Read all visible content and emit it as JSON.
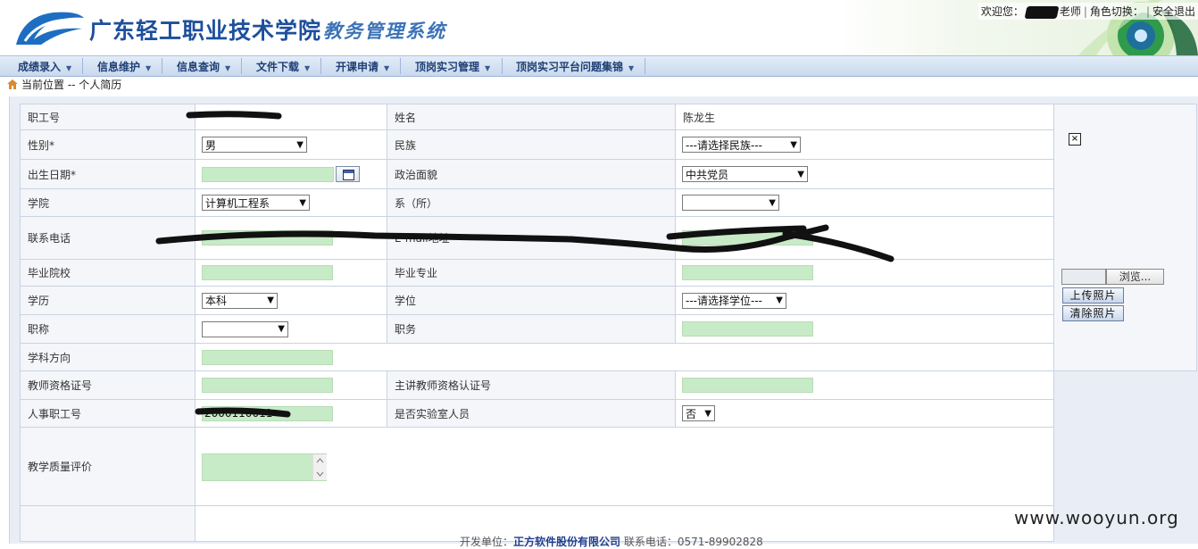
{
  "header": {
    "school_name": "广东轻工职业技术学院",
    "system_name": "教务管理系统",
    "welcome": "欢迎您：",
    "user_suffix": "老师",
    "role_switch": "角色切换：",
    "logout": "安全退出"
  },
  "nav": [
    "成绩录入",
    "信息维护",
    "信息查询",
    "文件下载",
    "开课申请",
    "顶岗实习管理",
    "顶岗实习平台问题集锦"
  ],
  "breadcrumb": "当前位置 -- 个人简历",
  "form": {
    "staff_no_label": "职工号",
    "name_label": "姓名",
    "name_value": "陈龙生",
    "gender_label": "性别*",
    "gender_value": "男",
    "ethnic_label": "民族",
    "ethnic_value": "---请选择民族---",
    "birth_label": "出生日期*",
    "political_label": "政治面貌",
    "political_value": "中共党员",
    "college_label": "学院",
    "college_value": "计算机工程系",
    "dept_label": "系（所）",
    "phone_label": "联系电话",
    "email_label": "E-mail地址",
    "school_label": "毕业院校",
    "major_label": "毕业专业",
    "edu_label": "学历",
    "edu_value": "本科",
    "degree_label": "学位",
    "degree_value": "---请选择学位---",
    "title_label": "职称",
    "post_label": "职务",
    "subject_label": "学科方向",
    "cert_label": "教师资格证号",
    "lecturer_label": "主讲教师资格认证号",
    "hr_no_label": "人事职工号",
    "hr_no_value": "2000110011",
    "lab_label": "是否实验室人员",
    "lab_value": "否",
    "eval_label": "教学质量评价"
  },
  "photo": {
    "browse": "浏览...",
    "upload": "上传照片",
    "clear": "清除照片"
  },
  "footer": {
    "dev_label": "开发单位：",
    "company": "正方软件股份有限公司",
    "phone": "联系电话：0571-89902828"
  },
  "watermark": "www.wooyun.org"
}
